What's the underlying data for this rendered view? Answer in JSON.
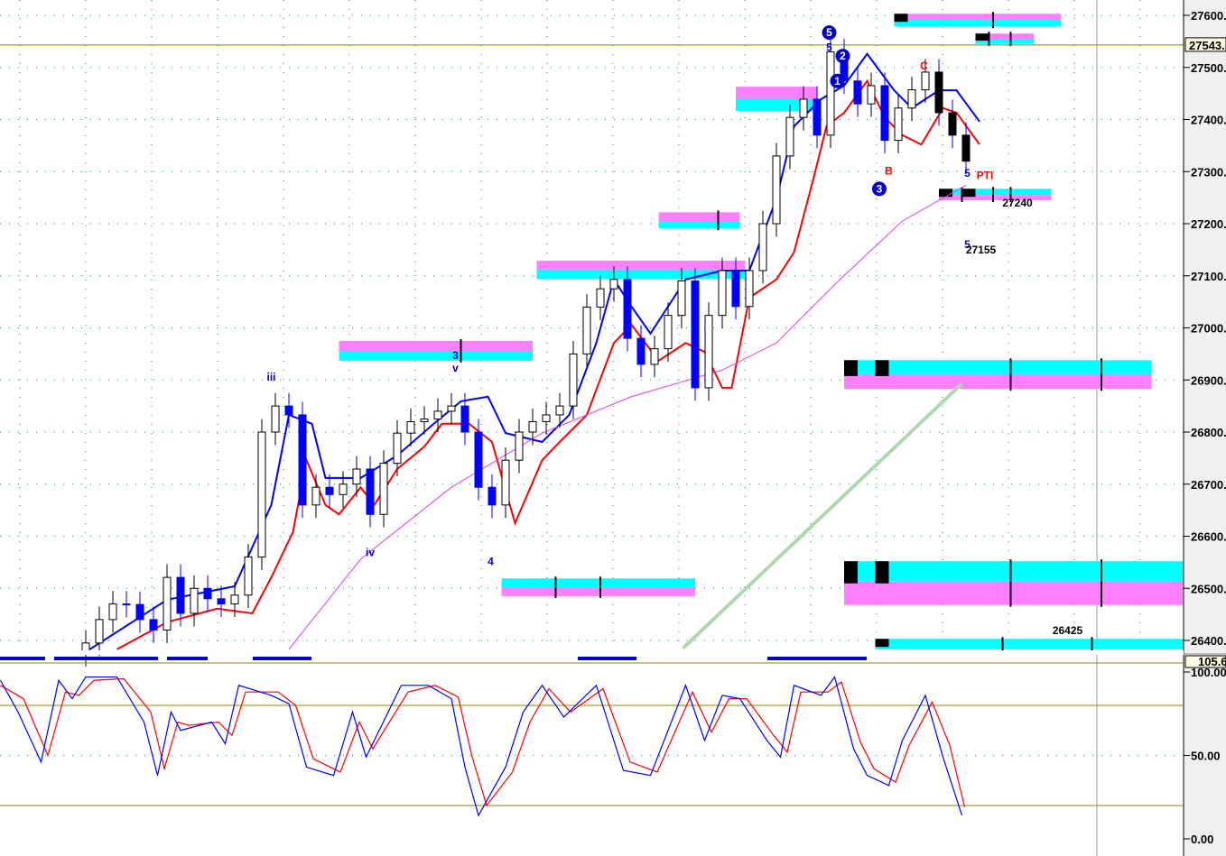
{
  "chart_data": {
    "type": "candlestick",
    "price_axis": {
      "ticks": [
        "27600.",
        "27500.",
        "27400.",
        "27300.",
        "27200.",
        "27100.",
        "27000.",
        "26900.",
        "26800.",
        "26700.",
        "26600.",
        "26500.",
        "26400."
      ],
      "tick_values": [
        27600,
        27500,
        27400,
        27300,
        27200,
        27100,
        27000,
        26900,
        26800,
        26700,
        26600,
        26500,
        26400
      ],
      "range": [
        26385,
        27605
      ]
    },
    "last_price": {
      "label": "27543.",
      "value": 27543
    },
    "closes": [
      26395,
      26440,
      26470,
      26469,
      26440,
      26420,
      26521,
      26452,
      26500,
      26480,
      26470,
      26487,
      26560,
      26800,
      26850,
      26833,
      26660,
      26694,
      26680,
      26700,
      26729,
      26642,
      26740,
      26798,
      26820,
      26825,
      26840,
      26850,
      26800,
      26694,
      26660,
      26746,
      26800,
      26820,
      26833,
      26850,
      26950,
      27040,
      27075,
      27093,
      26980,
      26930,
      26960,
      27024,
      27090,
      26885,
      27024,
      27110,
      27041,
      27110,
      27200,
      27330,
      27404,
      27439,
      27370,
      27530,
      27474,
      27430,
      27465,
      27360,
      27422,
      27457,
      27491,
      27413,
      27370,
      27320
    ],
    "series": [
      {
        "name": "upper band",
        "color": "#0000ff",
        "points": [
          [
            0.3,
            26383
          ],
          [
            6,
            26478
          ],
          [
            11,
            26504
          ],
          [
            13.7,
            26660
          ],
          [
            15,
            26833
          ],
          [
            16.7,
            26816
          ],
          [
            17.7,
            26712
          ],
          [
            20.3,
            26712
          ],
          [
            23,
            26755
          ],
          [
            25.7,
            26816
          ],
          [
            27.7,
            26859
          ],
          [
            29.7,
            26868
          ],
          [
            31,
            26798
          ],
          [
            33.7,
            26781
          ],
          [
            35.7,
            26833
          ],
          [
            37.7,
            26971
          ],
          [
            39,
            27093
          ],
          [
            40.3,
            27041
          ],
          [
            41.7,
            26989
          ],
          [
            44.3,
            27093
          ],
          [
            47,
            27110
          ],
          [
            49,
            27110
          ],
          [
            51,
            27248
          ],
          [
            52.3,
            27387
          ],
          [
            54.3,
            27439
          ],
          [
            56,
            27465
          ],
          [
            57.7,
            27526
          ],
          [
            59.7,
            27456
          ],
          [
            61,
            27422
          ],
          [
            63,
            27456
          ],
          [
            64.3,
            27456
          ],
          [
            66,
            27396
          ]
        ]
      },
      {
        "name": "lower band",
        "color": "#ff0000",
        "points": [
          [
            2.3,
            26383
          ],
          [
            6,
            26435
          ],
          [
            9.7,
            26461
          ],
          [
            12.3,
            26452
          ],
          [
            13.7,
            26521
          ],
          [
            15.3,
            26608
          ],
          [
            16.3,
            26746
          ],
          [
            17.7,
            26660
          ],
          [
            18.7,
            26642
          ],
          [
            20.3,
            26694
          ],
          [
            21.3,
            26660
          ],
          [
            23,
            26729
          ],
          [
            25,
            26772
          ],
          [
            26.3,
            26816
          ],
          [
            28.3,
            26816
          ],
          [
            30,
            26781
          ],
          [
            31.7,
            26625
          ],
          [
            33.7,
            26746
          ],
          [
            35,
            26781
          ],
          [
            37,
            26833
          ],
          [
            39,
            26971
          ],
          [
            40.3,
            27006
          ],
          [
            42.3,
            26937
          ],
          [
            44.3,
            26971
          ],
          [
            45.7,
            26954
          ],
          [
            47,
            26885
          ],
          [
            47.7,
            26885
          ],
          [
            49,
            27058
          ],
          [
            51,
            27093
          ],
          [
            52.3,
            27145
          ],
          [
            53.7,
            27283
          ],
          [
            54.7,
            27387
          ],
          [
            56,
            27413
          ],
          [
            57.7,
            27474
          ],
          [
            59,
            27404
          ],
          [
            60.3,
            27370
          ],
          [
            61.7,
            27352
          ],
          [
            63.3,
            27422
          ],
          [
            64.3,
            27413
          ],
          [
            66,
            27352
          ]
        ]
      },
      {
        "name": "moving average",
        "color": "#e040e0",
        "points": [
          [
            15,
            26383
          ],
          [
            20.3,
            26556
          ],
          [
            27,
            26694
          ],
          [
            33.7,
            26798
          ],
          [
            40.3,
            26868
          ],
          [
            47,
            26919
          ],
          [
            51,
            26971
          ],
          [
            55.7,
            27093
          ],
          [
            60.3,
            27205
          ],
          [
            65,
            27274
          ]
        ]
      },
      {
        "name": "trend line",
        "color": "#b0d8b0",
        "points": [
          [
            44.1,
            26385
          ],
          [
            64.7,
            26893
          ]
        ]
      }
    ],
    "zones": [
      {
        "from": 18.7,
        "to": 33,
        "top": 26975,
        "mid": 26956,
        "bottom": 26937,
        "top_color": "#ff80ff",
        "bottom_color": "#00ffff",
        "ticks": [
          27.7
        ]
      },
      {
        "from": 30.7,
        "to": 45,
        "top": 26519,
        "mid": 26502,
        "bottom": 26485,
        "top_color": "#00ffff",
        "bottom_color": "#ff80ff",
        "ticks": [
          34.7,
          38
        ]
      },
      {
        "from": 33.3,
        "to": 48.7,
        "top": 27129,
        "mid": 27112,
        "bottom": 27094,
        "top_color": "#ff80ff",
        "bottom_color": "#00ffff",
        "ticks": []
      },
      {
        "from": 42.3,
        "to": 48.3,
        "top": 27222,
        "mid": 27205,
        "bottom": 27191,
        "top_color": "#ff80ff",
        "bottom_color": "#00ffff",
        "ticks": [
          46.7
        ]
      },
      {
        "from": 48,
        "to": 54,
        "top": 27463,
        "mid": 27439,
        "bottom": 27416,
        "top_color": "#ff80ff",
        "bottom_color": "#00ffff",
        "ticks": []
      },
      {
        "from": 59.7,
        "to": 72,
        "top": 27603,
        "mid": 27591,
        "bottom": 27579,
        "top_color": "#ff80ff",
        "bottom_color": "#00ffff",
        "ticks": [
          67
        ],
        "blocks": [
          [
            59.7,
            60.7
          ]
        ]
      },
      {
        "from": 65.7,
        "to": 70,
        "top": 27565,
        "mid": 27555,
        "bottom": 27545,
        "top_color": "#ff80ff",
        "bottom_color": "#00ffff",
        "ticks": [
          66.7,
          68.3
        ],
        "blocks": [
          [
            65.7,
            66.7
          ]
        ]
      },
      {
        "from": 63,
        "to": 71.3,
        "top": 27267,
        "mid": 27255,
        "bottom": 27245,
        "top_color": "#00ffff",
        "bottom_color": "#ff80ff",
        "ticks": [
          64.7,
          67,
          68.3
        ],
        "blocks": [
          [
            63,
            64
          ],
          [
            64.7,
            65.7
          ]
        ]
      },
      {
        "from": 56,
        "to": 78.7,
        "top": 26938,
        "mid": 26911,
        "bottom": 26883,
        "top_color": "#00ffff",
        "bottom_color": "#ff80ff",
        "ticks": [
          68.3,
          75
        ],
        "blocks": [
          [
            56,
            57
          ],
          [
            58.3,
            59.3
          ]
        ]
      },
      {
        "from": 56,
        "to": 81,
        "top": 26552,
        "mid": 26513,
        "bottom": 26468,
        "top_color": "#00ffff",
        "bottom_color": "#ff80ff",
        "ticks": [
          68.3,
          75
        ],
        "blocks": [
          [
            56,
            57
          ],
          [
            58.3,
            59.3
          ]
        ]
      },
      {
        "from": 58.3,
        "to": 81,
        "top": 26403,
        "mid": 26391,
        "bottom": 26383,
        "top_color": "#00ffff",
        "bottom_color": "#00ffff",
        "ticks": [
          67.7,
          74.3
        ],
        "blocks": [
          [
            58.3,
            59.3
          ]
        ]
      }
    ],
    "annotations": [
      {
        "text": "iii",
        "i": 13.7,
        "p": 26899,
        "color": "#0000cc",
        "circled": false
      },
      {
        "text": "3",
        "i": 27.3,
        "p": 26940,
        "color": "#0000cc",
        "circled": false
      },
      {
        "text": "v",
        "i": 27.3,
        "p": 26916,
        "color": "#0000cc",
        "circled": false
      },
      {
        "text": "iv",
        "i": 21,
        "p": 26562,
        "color": "#0000cc",
        "circled": false
      },
      {
        "text": "4",
        "i": 29.9,
        "p": 26545,
        "color": "#0000cc",
        "circled": false
      },
      {
        "text": "5",
        "i": 54.9,
        "p": 27532,
        "color": "#0000cc",
        "circled": false
      },
      {
        "text": "5",
        "i": 54.9,
        "p": 27560,
        "color": "#0000cc",
        "circled": true
      },
      {
        "text": "2",
        "i": 55.9,
        "p": 27515,
        "color": "#0000cc",
        "circled": true
      },
      {
        "text": "1",
        "i": 55.5,
        "p": 27467,
        "color": "#0000cc",
        "circled": true
      },
      {
        "text": "3",
        "i": 58.6,
        "p": 27260,
        "color": "#0000cc",
        "circled": true
      },
      {
        "text": "B",
        "i": 59.3,
        "p": 27294,
        "color": "#ff0000",
        "circled": false
      },
      {
        "text": "C",
        "i": 61.9,
        "p": 27496,
        "color": "#ff0000",
        "circled": false
      },
      {
        "text": "5",
        "i": 65.1,
        "p": 27290,
        "color": "#0000cc",
        "circled": false
      },
      {
        "text": "PTI",
        "i": 66.4,
        "p": 27286,
        "color": "#ff0000",
        "circled": false
      },
      {
        "text": "27240",
        "i": 68.8,
        "p": 27233,
        "color": "#000000",
        "circled": false
      },
      {
        "text": "5",
        "i": 65.1,
        "p": 27153,
        "color": "#0000cc",
        "circled": false
      },
      {
        "text": "27155",
        "i": 66.1,
        "p": 27143,
        "color": "#000000",
        "circled": false
      },
      {
        "text": "26425",
        "i": 72.5,
        "p": 26412,
        "color": "#000000",
        "circled": false
      }
    ],
    "oscillator": {
      "current_label": "105.6",
      "ticks": [
        "100.00",
        "50.00",
        "0.00"
      ],
      "tick_values": [
        100,
        50,
        0
      ],
      "levels": [
        80,
        20
      ],
      "k": [
        [
          -6.3,
          95
        ],
        [
          -5,
          76
        ],
        [
          -3.3,
          46
        ],
        [
          -2,
          95
        ],
        [
          -1,
          84
        ],
        [
          0,
          97
        ],
        [
          2.3,
          97
        ],
        [
          4.3,
          70
        ],
        [
          5.3,
          38
        ],
        [
          6.3,
          76
        ],
        [
          7,
          65
        ],
        [
          9.3,
          70
        ],
        [
          10.3,
          57
        ],
        [
          11.3,
          92
        ],
        [
          13.7,
          86
        ],
        [
          15,
          81
        ],
        [
          16.3,
          43
        ],
        [
          18.3,
          38
        ],
        [
          19.7,
          76
        ],
        [
          20.7,
          49
        ],
        [
          23.3,
          92
        ],
        [
          25.3,
          92
        ],
        [
          27,
          84
        ],
        [
          28,
          43
        ],
        [
          29,
          14
        ],
        [
          31,
          43
        ],
        [
          32.3,
          76
        ],
        [
          33.7,
          92
        ],
        [
          35.3,
          73
        ],
        [
          37.7,
          92
        ],
        [
          39.7,
          41
        ],
        [
          41.7,
          38
        ],
        [
          44.3,
          92
        ],
        [
          45.7,
          59
        ],
        [
          47,
          86
        ],
        [
          48.3,
          84
        ],
        [
          50.3,
          59
        ],
        [
          51.3,
          49
        ],
        [
          52.3,
          92
        ],
        [
          54.3,
          86
        ],
        [
          55.3,
          97
        ],
        [
          56.7,
          54
        ],
        [
          57.7,
          38
        ],
        [
          59.3,
          32
        ],
        [
          60.3,
          59
        ],
        [
          62,
          86
        ],
        [
          63.3,
          49
        ],
        [
          64.7,
          14
        ]
      ],
      "d": [
        [
          -6.3,
          92
        ],
        [
          -4.6,
          84
        ],
        [
          -2.8,
          50
        ],
        [
          -1.5,
          88
        ],
        [
          -0.5,
          86
        ],
        [
          0.6,
          95
        ],
        [
          2.8,
          96
        ],
        [
          4.8,
          76
        ],
        [
          5.8,
          42
        ],
        [
          6.8,
          70
        ],
        [
          7.6,
          68
        ],
        [
          9.8,
          70
        ],
        [
          10.8,
          62
        ],
        [
          11.8,
          88
        ],
        [
          14.2,
          88
        ],
        [
          15.5,
          80
        ],
        [
          16.8,
          48
        ],
        [
          18.8,
          40
        ],
        [
          20.2,
          70
        ],
        [
          21.2,
          54
        ],
        [
          23.8,
          88
        ],
        [
          25.8,
          92
        ],
        [
          27.5,
          85
        ],
        [
          28.5,
          50
        ],
        [
          29.6,
          20
        ],
        [
          31.5,
          40
        ],
        [
          32.8,
          70
        ],
        [
          34.2,
          90
        ],
        [
          35.8,
          76
        ],
        [
          38.2,
          90
        ],
        [
          40.2,
          46
        ],
        [
          42.2,
          40
        ],
        [
          44.8,
          88
        ],
        [
          46.2,
          64
        ],
        [
          47.5,
          84
        ],
        [
          48.8,
          84
        ],
        [
          50.8,
          62
        ],
        [
          51.8,
          52
        ],
        [
          52.8,
          88
        ],
        [
          54.8,
          88
        ],
        [
          55.8,
          94
        ],
        [
          57.2,
          58
        ],
        [
          58.2,
          42
        ],
        [
          59.8,
          34
        ],
        [
          60.8,
          56
        ],
        [
          62.5,
          82
        ],
        [
          63.8,
          56
        ],
        [
          64.9,
          19
        ]
      ]
    }
  }
}
